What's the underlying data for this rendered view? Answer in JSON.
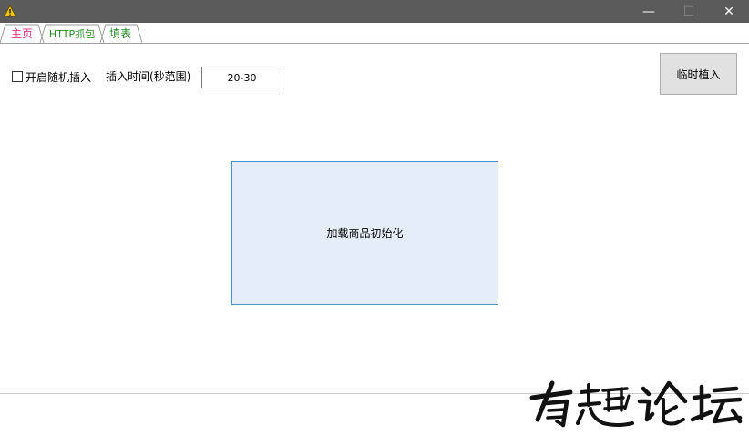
{
  "window": {
    "minimize_glyph": "—",
    "maximize_glyph": "☐",
    "close_glyph": "✕"
  },
  "tabs": [
    {
      "label": "主页",
      "color": "#e0358a",
      "active": true
    },
    {
      "label": "HTTP抓包",
      "color": "#1e8a1e",
      "active": false
    },
    {
      "label": "填表",
      "color": "#1e8a1e",
      "active": false
    }
  ],
  "controls": {
    "random_insert_label": "开启随机插入",
    "random_insert_checked": false,
    "interval_label": "插入时间(秒范围)",
    "interval_value": "20-30",
    "temp_insert_button": "临时植入"
  },
  "main": {
    "init_button": "加载商品初始化"
  },
  "watermark": {
    "text": "有趣论坛"
  },
  "icons": {
    "app": "warning-icon"
  }
}
